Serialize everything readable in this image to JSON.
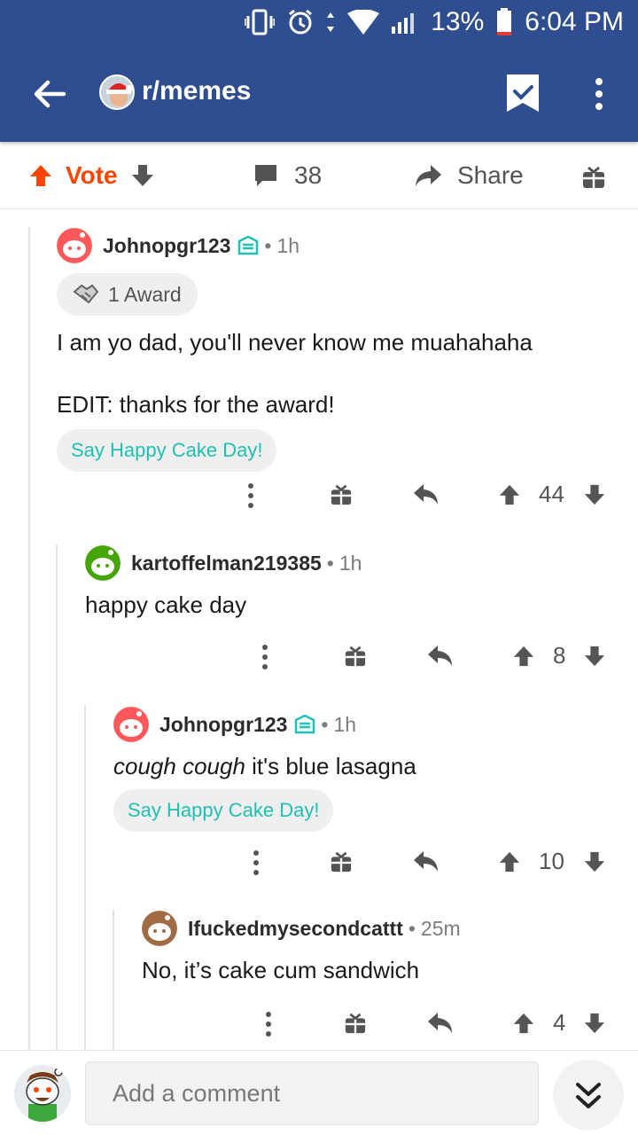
{
  "status": {
    "battery": "13%",
    "time": "6:04 PM"
  },
  "header": {
    "subreddit": "r/memes"
  },
  "post_actions": {
    "vote_label": "Vote",
    "comment_count": "38",
    "share_label": "Share"
  },
  "comments": [
    {
      "username": "Johnopgr123",
      "time": "1h",
      "award": "1 Award",
      "body_line1": "I am yo dad, you'll never know me muahahaha",
      "body_line2": "EDIT: thanks for the award!",
      "cake_label": "Say Happy Cake Day!",
      "score": "44"
    },
    {
      "username": "kartoffelman219385",
      "time": "1h",
      "body": "happy cake day",
      "score": "8"
    },
    {
      "username": "Johnopgr123",
      "time": "1h",
      "body_italic": "cough cough",
      "body_rest": " it's blue lasagna",
      "cake_label": "Say Happy Cake Day!",
      "score": "10"
    },
    {
      "username": "Ifuckedmysecondcattt",
      "time": "25m",
      "body": "No, it’s cake cum sandwich",
      "score": "4"
    }
  ],
  "composer": {
    "placeholder": "Add a comment"
  },
  "colors": {
    "header": "#2f4e8f",
    "upvote_active": "#ff4500",
    "cake_text": "#1fc0b4"
  }
}
